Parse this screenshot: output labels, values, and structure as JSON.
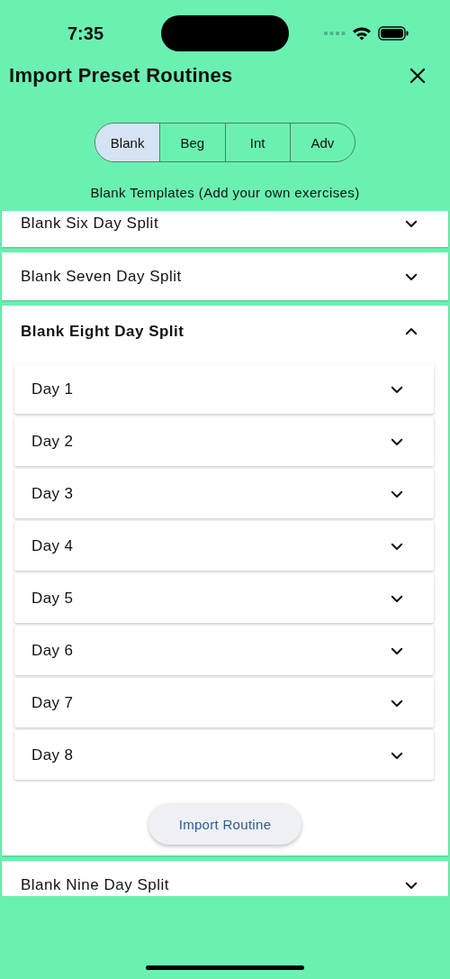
{
  "status_bar": {
    "time": "7:35"
  },
  "title": "Import Preset Routines",
  "segments": [
    {
      "label": "Blank",
      "selected": true
    },
    {
      "label": "Beg",
      "selected": false
    },
    {
      "label": "Int",
      "selected": false
    },
    {
      "label": "Adv",
      "selected": false
    }
  ],
  "subtitle": "Blank Templates (Add your own exercises)",
  "routines": [
    {
      "name": "Blank Six Day Split",
      "expanded": false
    },
    {
      "name": "Blank Seven Day Split",
      "expanded": false
    },
    {
      "name": "Blank Eight Day Split",
      "expanded": true,
      "action": "Import Routine",
      "days": [
        {
          "label": "Day 1",
          "expanded": false
        },
        {
          "label": "Day 2",
          "expanded": false
        },
        {
          "label": "Day 3",
          "expanded": false
        },
        {
          "label": "Day 4",
          "expanded": false
        },
        {
          "label": "Day 5",
          "expanded": false
        },
        {
          "label": "Day 6",
          "expanded": false
        },
        {
          "label": "Day 7",
          "expanded": false
        },
        {
          "label": "Day 8",
          "expanded": false
        }
      ]
    },
    {
      "name": "Blank Nine Day Split",
      "expanded": false
    }
  ]
}
